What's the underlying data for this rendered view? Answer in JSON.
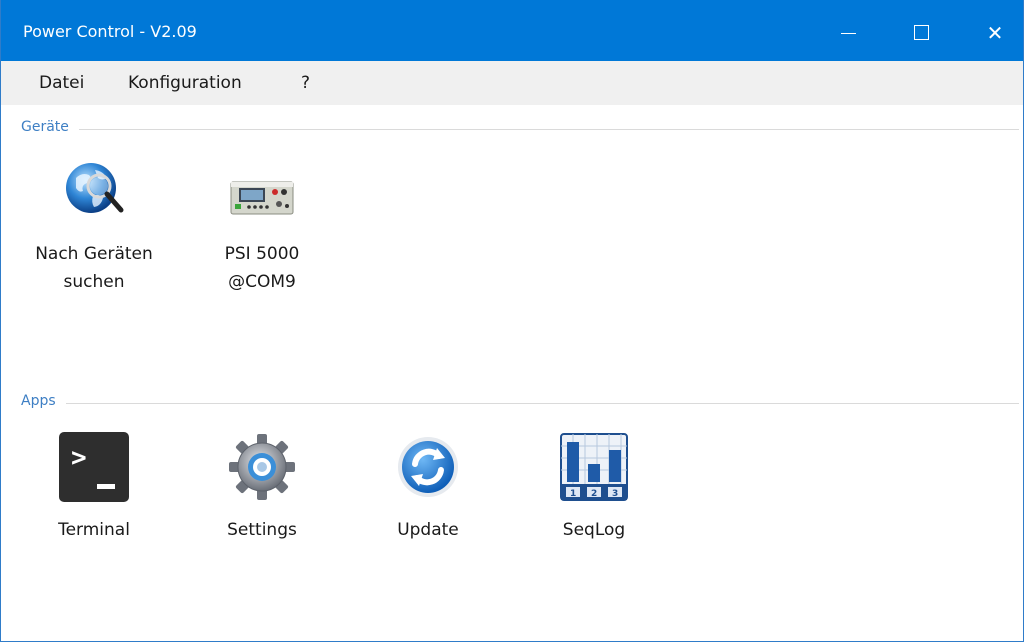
{
  "window": {
    "title": "Power Control - V2.09",
    "controls": {
      "minimize": "",
      "maximize": "",
      "close": "✕"
    }
  },
  "menu": {
    "items": [
      "Datei",
      "Konfiguration",
      "?"
    ]
  },
  "sections": {
    "devices": {
      "label": "Geräte",
      "tiles": [
        {
          "line1": "Nach Geräten",
          "line2": "suchen",
          "icon": "globe-search-icon"
        },
        {
          "line1": "PSI 5000",
          "line2": "@COM9",
          "icon": "power-supply-device-icon"
        }
      ]
    },
    "apps": {
      "label": "Apps",
      "tiles": [
        {
          "label": "Terminal",
          "icon": "terminal-icon"
        },
        {
          "label": "Settings",
          "icon": "gear-icon"
        },
        {
          "label": "Update",
          "icon": "refresh-icon"
        },
        {
          "label": "SeqLog",
          "icon": "seqlog-chart-icon"
        }
      ]
    }
  },
  "colors": {
    "titlebar": "#0078d7",
    "section_label": "#3e7fc4",
    "menubar": "#f0f0f0"
  }
}
